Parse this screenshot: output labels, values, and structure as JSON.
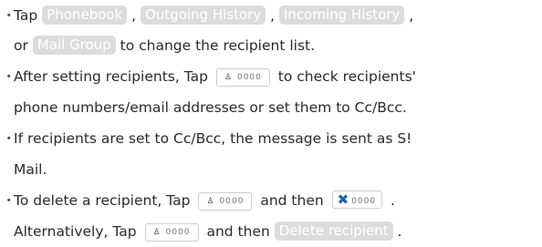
{
  "bullet": "・",
  "keys": {
    "phonebook": "Phonebook",
    "outgoing": "Outgoing History",
    "incoming": "Incoming History",
    "mail_group": "Mail Group",
    "delete_recipient": "Delete recipient"
  },
  "recipient_chip": {
    "person": "♙",
    "digits": "0000"
  },
  "remove_chip": {
    "x": "✖",
    "digits": "0000"
  },
  "text": {
    "l1_a": "Tap ",
    "l1_sep1": " , ",
    "l1_sep2": " , ",
    "l1_sep3": " ,",
    "l2_a": "or ",
    "l2_b": " to change the recipient list.",
    "l3_a": "After setting recipients, Tap ",
    "l3_b": " to check recipients'",
    "l4": "phone numbers/email addresses or set them to Cc/Bcc.",
    "l5": "If recipients are set to Cc/Bcc, the message is sent as S!",
    "l6": "Mail.",
    "l7_a": "To delete a recipient, Tap ",
    "l7_b": " and then ",
    "l7_c": " .",
    "l8_a": "Alternatively, Tap ",
    "l8_b": " and then ",
    "l8_c": " ."
  }
}
